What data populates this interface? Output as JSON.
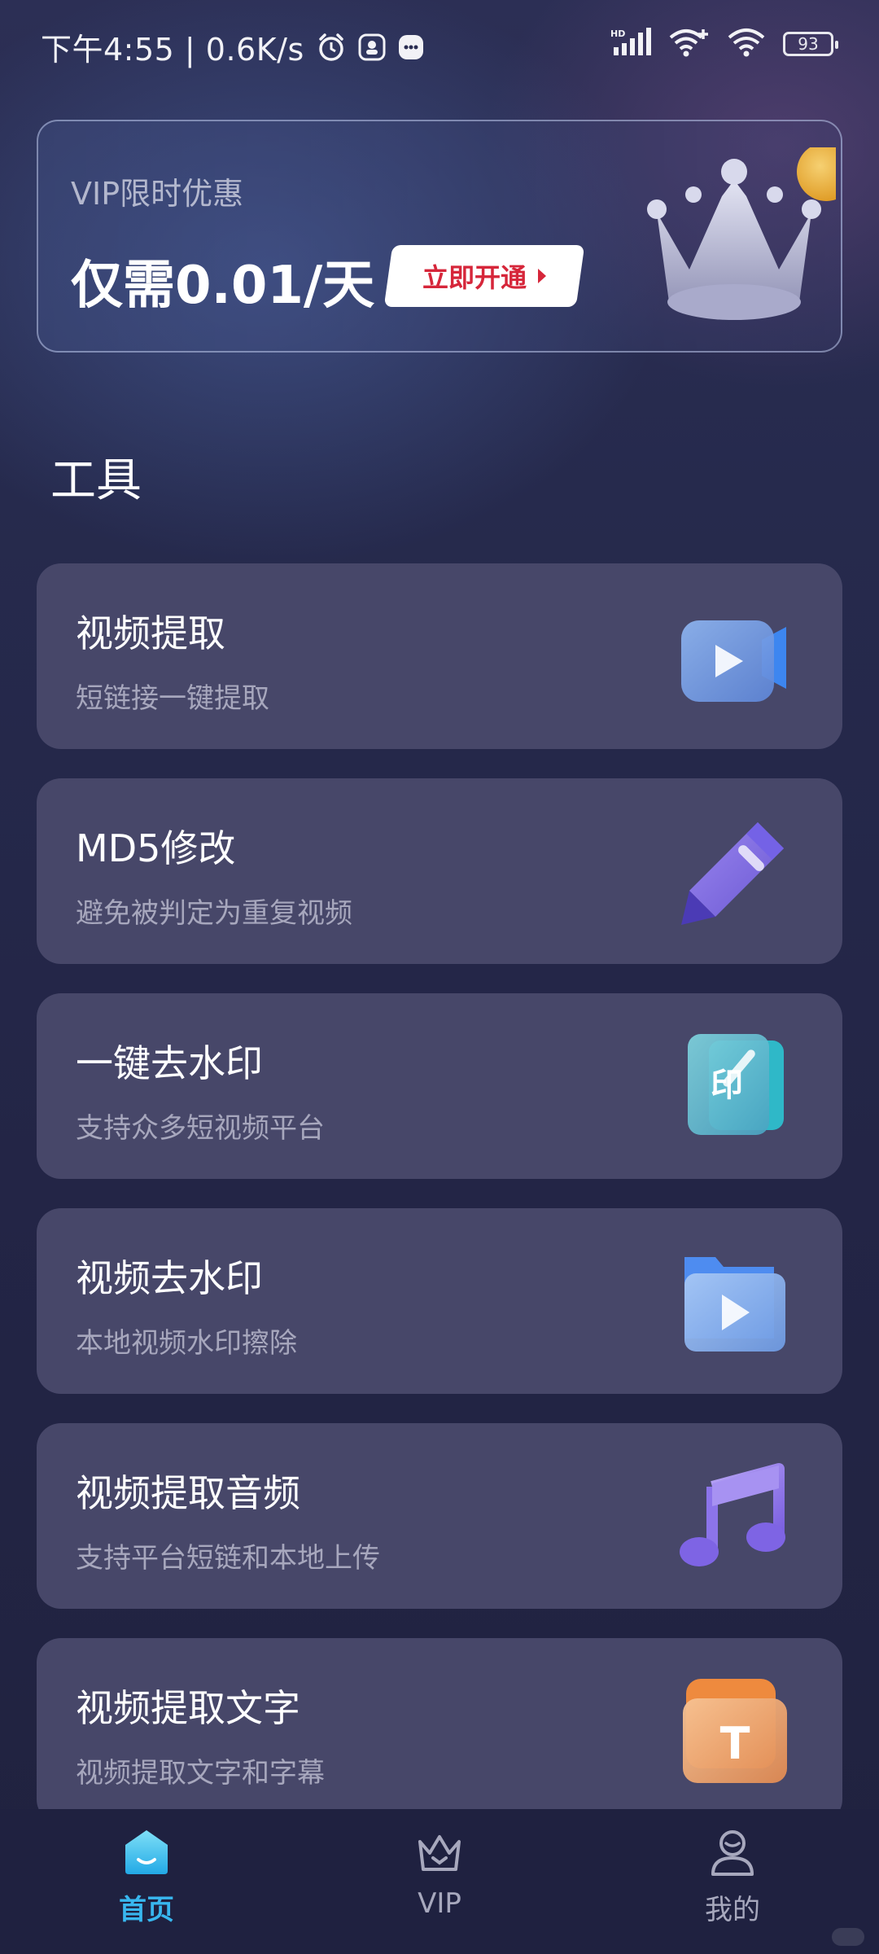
{
  "status_bar": {
    "time_and_speed": "下午4:55 | 0.6K/s",
    "network_label": "HD",
    "battery": "93"
  },
  "vip_banner": {
    "subtitle": "VIP限时优惠",
    "price": "仅需0.01/天",
    "button_label": "立即开通"
  },
  "tools_section": {
    "title": "工具",
    "items": [
      {
        "title": "视频提取",
        "desc": "短链接一键提取",
        "icon": "video-camera-icon"
      },
      {
        "title": "MD5修改",
        "desc": "避免被判定为重复视频",
        "icon": "pencil-icon"
      },
      {
        "title": "一键去水印",
        "desc": "支持众多短视频平台",
        "icon": "stamp-icon",
        "icon_text": "印"
      },
      {
        "title": "视频去水印",
        "desc": "本地视频水印擦除",
        "icon": "video-folder-icon"
      },
      {
        "title": "视频提取音频",
        "desc": "支持平台短链和本地上传",
        "icon": "music-note-icon"
      },
      {
        "title": "视频提取文字",
        "desc": "视频提取文字和字幕",
        "icon": "text-icon",
        "icon_text": "T"
      }
    ]
  },
  "bottom_nav": {
    "items": [
      {
        "label": "首页",
        "icon": "home-icon",
        "active": true
      },
      {
        "label": "VIP",
        "icon": "vip-crown-icon",
        "active": false
      },
      {
        "label": "我的",
        "icon": "profile-icon",
        "active": false
      }
    ]
  },
  "colors": {
    "accent": "#38b7ef",
    "vip_button_text": "#d6263a",
    "card_bg": "#474769"
  }
}
